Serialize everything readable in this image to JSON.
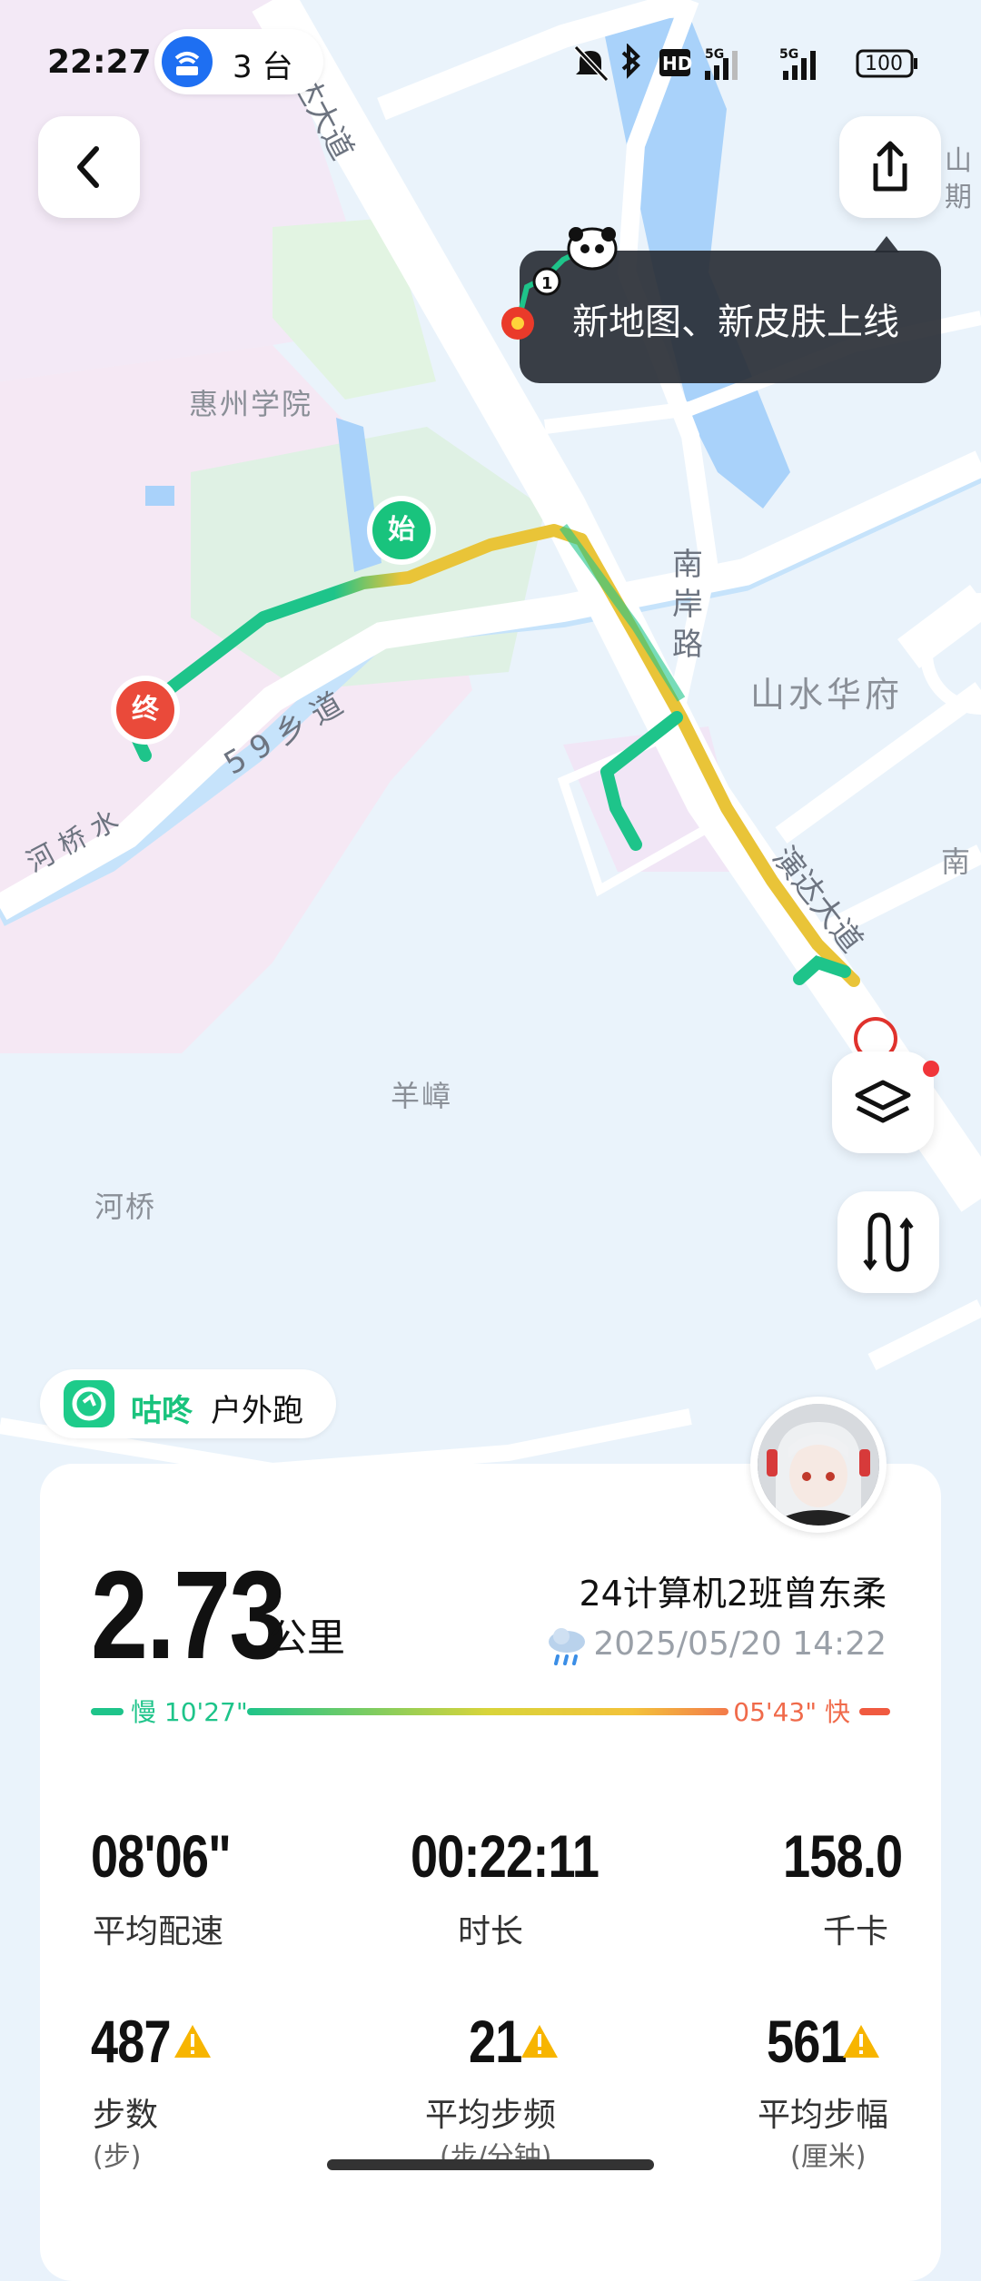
{
  "status_bar": {
    "time": "22:27",
    "hotspot_count": "3 台",
    "battery": "100"
  },
  "tooltip": {
    "text": "新地图、新皮肤上线"
  },
  "map": {
    "labels": {
      "huizhou_college": "惠州学院",
      "shanshui_huafu": "山水华府",
      "yangzhang": "羊嶂",
      "heqiao": "河桥",
      "heqiao_water": "河 桥 水",
      "road_59": "5 9 乡 道",
      "nan_an_road": "南 岸 路",
      "yanda_avenue_top": "演达大道",
      "yanda_avenue_bottom": "演达大道",
      "shan_qi": "山 期",
      "nan_edge": "南"
    },
    "markers": {
      "start": "始",
      "end": "终"
    }
  },
  "brand": {
    "name": "咕咚",
    "type": "户外跑"
  },
  "summary": {
    "distance": "2.73",
    "unit": "公里",
    "user_name": "24计算机2班曾东柔",
    "datetime": "2025/05/20 14:22",
    "pace_slow": "慢 10'27\"",
    "pace_fast": "05'43\" 快"
  },
  "stats": [
    {
      "value": "08'06\"",
      "label": "平均配速"
    },
    {
      "value": "00:22:11",
      "label": "时长"
    },
    {
      "value": "158.0",
      "label": "千卡"
    },
    {
      "value": "487",
      "label": "步数",
      "unit": "(步)"
    },
    {
      "value": "21",
      "label": "平均步频",
      "unit": "(步/分钟)"
    },
    {
      "value": "561",
      "label": "平均步幅",
      "unit": "(厘米)"
    }
  ]
}
